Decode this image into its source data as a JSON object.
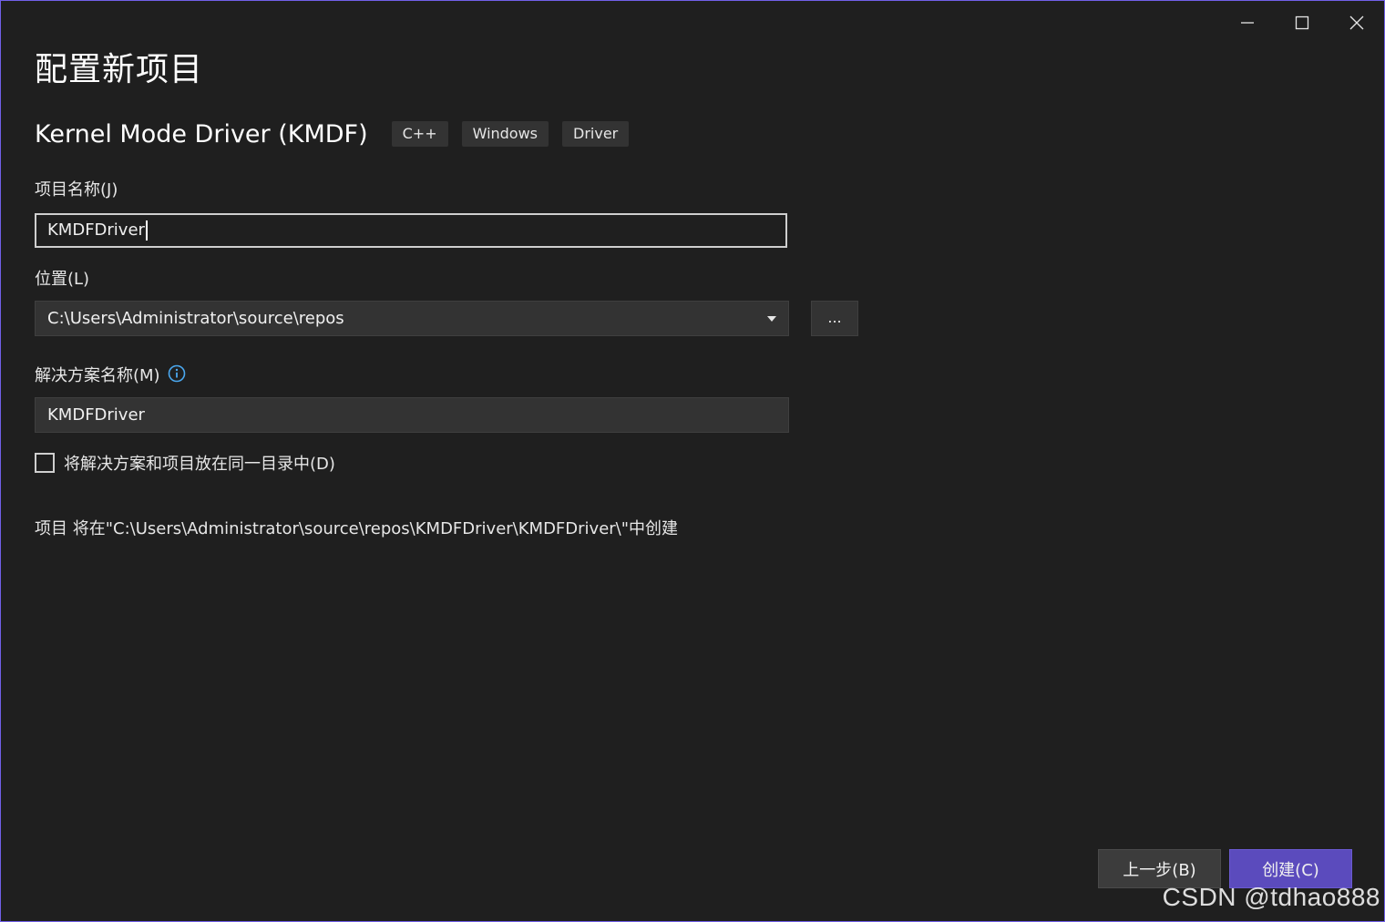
{
  "window": {
    "title": "配置新项目",
    "controls": [
      "minimize-icon",
      "maximize-icon",
      "close-icon"
    ],
    "border_color": "#7160e8"
  },
  "template": {
    "name": "Kernel Mode Driver (KMDF)",
    "tags": [
      "C++",
      "Windows",
      "Driver"
    ]
  },
  "project_name": {
    "label": "项目名称(J)",
    "value": "KMDFDriver"
  },
  "location": {
    "label": "位置(L)",
    "value": "C:\\Users\\Administrator\\source\\repos",
    "browse_label": "..."
  },
  "solution_name": {
    "label": "解决方案名称(M)",
    "value": "KMDFDriver",
    "info_icon": "info-icon"
  },
  "same_directory": {
    "label": "将解决方案和项目放在同一目录中(D)",
    "checked": false
  },
  "path_note": "项目 将在\"C:\\Users\\Administrator\\source\\repos\\KMDFDriver\\KMDFDriver\\\"中创建",
  "footer": {
    "back_label": "上一步(B)",
    "create_label": "创建(C)",
    "accent_color": "#5b4bbd"
  },
  "watermark": "CSDN @tdhao888"
}
